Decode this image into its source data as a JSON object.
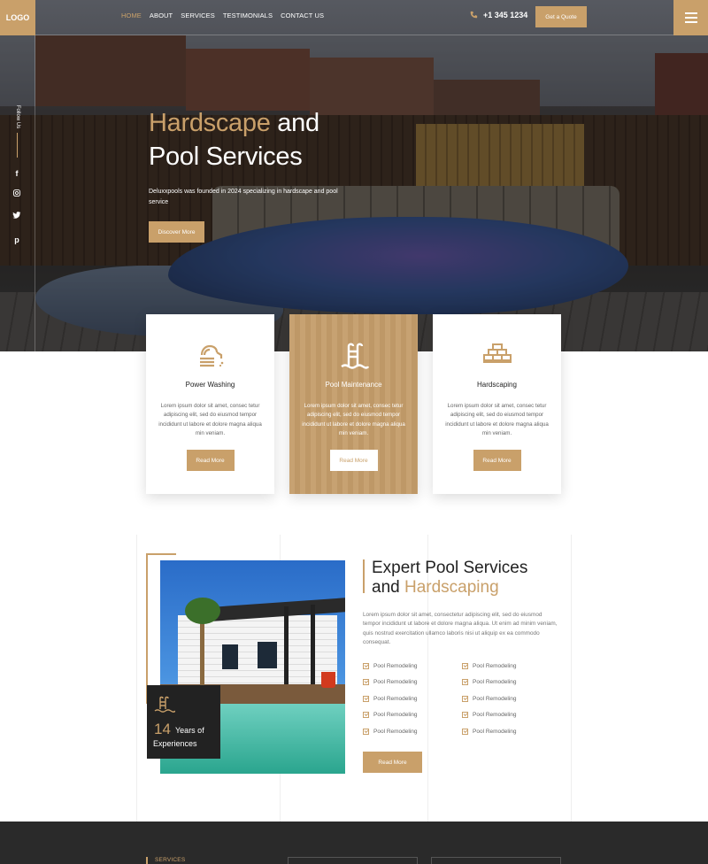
{
  "brand": {
    "logo": "LOGO",
    "accent": "#c9a06a",
    "dark": "#2a2a2a"
  },
  "nav": {
    "items": [
      "HOME",
      "ABOUT",
      "SERVICES",
      "TESTIMONIALS",
      "CONTACT US"
    ],
    "active": "HOME",
    "phone": "+1 345 1234",
    "phone_icon": "phone-icon",
    "quote_label": "Get a Quote",
    "menu_icon": "hamburger-icon"
  },
  "social": {
    "follow_label": "Follow Us",
    "icons": [
      "facebook-icon",
      "instagram-icon",
      "twitter-icon",
      "pinterest-icon"
    ]
  },
  "hero": {
    "title_gold": "Hardscape",
    "title_rest1": " and",
    "title_line2": "Pool Services",
    "subtitle": "Deluxxpools was founded in 2024 specializing in hardscape and pool service",
    "button": "Discover More"
  },
  "services": [
    {
      "title": "Power Washing",
      "icon": "hose-icon",
      "text": "Lorem ipsum dolor sit amet, consec tetur adipiscing elit, sed do eiusmod tempor incididunt ut labore et dolore magna aliqua min veniam.",
      "button": "Read More"
    },
    {
      "title": "Pool Maintenance",
      "icon": "pool-ladder-icon",
      "text": "Lorem ipsum dolor sit amet, consec tetur adipiscing elit, sed do eiusmod tempor incididunt ut labore et dolore magna aliqua min veniam.",
      "button": "Read More"
    },
    {
      "title": "Hardscaping",
      "icon": "bricks-icon",
      "text": "Lorem ipsum dolor sit amet, consec tetur adipiscing elit, sed do eiusmod tempor incididunt ut labore et dolore magna aliqua min veniam.",
      "button": "Read More"
    }
  ],
  "about": {
    "heading_line1": "Expert Pool Services",
    "heading_and": "and ",
    "heading_gold": "Hardscaping",
    "paragraph": "Lorem ipsum dolor sit amet, consectetur adipiscing elit, sed do eiusmod tempor incididunt ut labore et dolore magna aliqua. Ut enim ad minim veniam, quis nostrud exercitation ullamco laboris nisi ut aliquip ex ea commodo consequat.",
    "features_left": [
      "Pool Remodeling",
      "Pool Remodeling",
      "Pool Remodeling",
      "Pool Remodeling",
      "Pool Remodeling"
    ],
    "features_right": [
      "Pool Remodeling",
      "Pool Remodeling",
      "Pool Remodeling",
      "Pool Remodeling",
      "Pool Remodeling"
    ],
    "experience_number": "14",
    "experience_years": "Years of",
    "experience_label": "Experiences",
    "button": "Read More"
  },
  "footer": {
    "services_label": "SERVICES"
  }
}
